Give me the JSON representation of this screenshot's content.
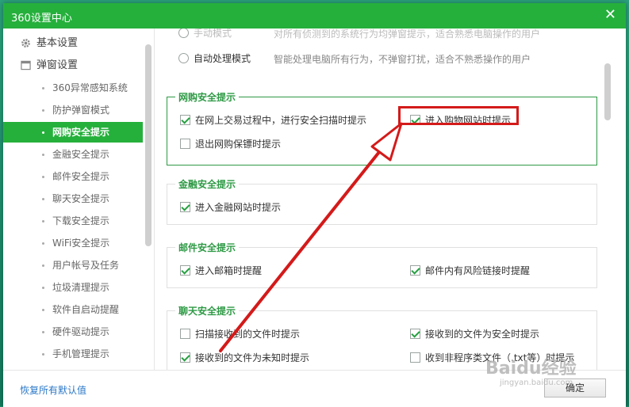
{
  "window": {
    "title": "360设置中心",
    "close_glyph": "✕"
  },
  "sidebar": {
    "items": [
      {
        "label": "基本设置",
        "icon": "gear-icon",
        "level": "top"
      },
      {
        "label": "弹窗设置",
        "icon": "window-icon",
        "level": "top"
      },
      {
        "label": "360异常感知系统",
        "level": "sub"
      },
      {
        "label": "防护弹窗模式",
        "level": "sub"
      },
      {
        "label": "网购安全提示",
        "level": "sub",
        "active": true
      },
      {
        "label": "金融安全提示",
        "level": "sub"
      },
      {
        "label": "邮件安全提示",
        "level": "sub"
      },
      {
        "label": "聊天安全提示",
        "level": "sub"
      },
      {
        "label": "下载安全提示",
        "level": "sub"
      },
      {
        "label": "WiFi安全提示",
        "level": "sub"
      },
      {
        "label": "用户帐号及任务",
        "level": "sub"
      },
      {
        "label": "垃圾清理提示",
        "level": "sub"
      },
      {
        "label": "软件自启动提醒",
        "level": "sub"
      },
      {
        "label": "硬件驱动提示",
        "level": "sub"
      },
      {
        "label": "手机管理提示",
        "level": "sub"
      }
    ]
  },
  "popup_mode": {
    "manual_label": "手动模式",
    "manual_desc": "对所有侦测到的系统行为均弹窗提示，适合熟悉电脑操作的用户",
    "auto_label": "自动处理模式",
    "auto_desc": "智能处理电脑所有行为，不弹窗打扰，适合不熟悉操作的用户"
  },
  "shopping": {
    "title": "网购安全提示",
    "opt1": "在网上交易过程中，进行安全扫描时提示",
    "opt2": "进入购物网站时提示",
    "opt3": "退出网购保镖时提示"
  },
  "finance": {
    "title": "金融安全提示",
    "opt1": "进入金融网站时提示"
  },
  "mail": {
    "title": "邮件安全提示",
    "opt1": "进入邮箱时提醒",
    "opt2": "邮件内有风险链接时提醒"
  },
  "chat": {
    "title": "聊天安全提示",
    "opt1": "扫描接收到的文件时提示",
    "opt2": "接收到的文件为安全时提示",
    "opt3": "接收到的文件为未知时提示",
    "opt4": "收到非程序类文件（.txt等）时提示"
  },
  "footer": {
    "restore_label": "恢复所有默认值",
    "ok_label": "确定"
  },
  "watermark": {
    "brand": "Baidu经验",
    "url": "jingyan.baidu.com"
  },
  "colors": {
    "accent": "#25b03c",
    "annotation": "#d41a1a",
    "link": "#2b78c7"
  }
}
